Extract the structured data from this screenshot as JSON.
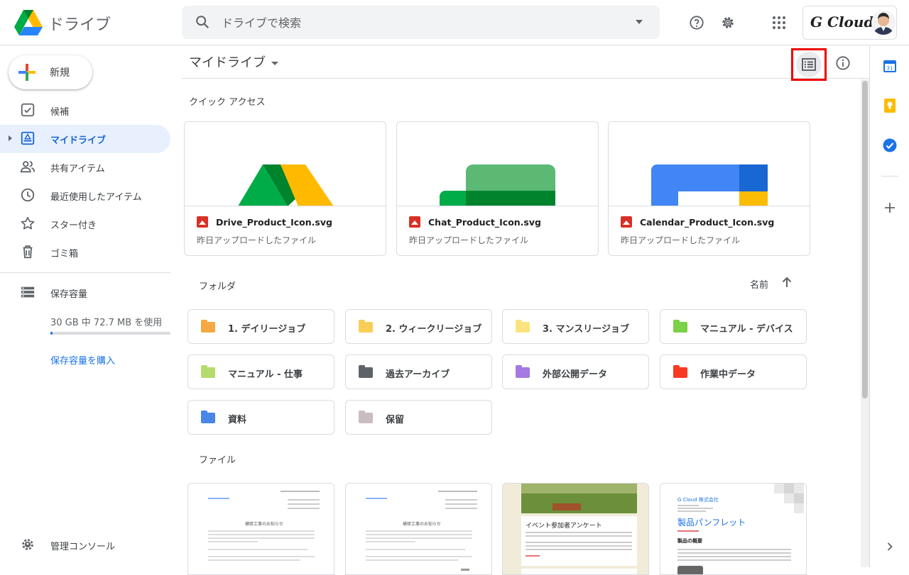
{
  "header": {
    "app_title": "ドライブ",
    "search_placeholder": "ドライブで検索",
    "account_brand": "G Cloud"
  },
  "sidebar": {
    "new_label": "新規",
    "items": [
      {
        "label": "候補",
        "icon": "suggested-icon"
      },
      {
        "label": "マイドライブ",
        "icon": "my-drive-icon",
        "active": true
      },
      {
        "label": "共有アイテム",
        "icon": "shared-icon"
      },
      {
        "label": "最近使用したアイテム",
        "icon": "recent-icon"
      },
      {
        "label": "スター付き",
        "icon": "star-icon"
      },
      {
        "label": "ゴミ箱",
        "icon": "trash-icon"
      }
    ],
    "storage_label": "保存容量",
    "storage_usage": "30 GB 中 72.7 MB を使用",
    "storage_fraction": 0.0024,
    "buy_storage": "保存容量を購入",
    "admin_console": "管理コンソール"
  },
  "main": {
    "title": "マイドライブ",
    "quick_access_title": "クイック アクセス",
    "quick_access": [
      {
        "name": "Drive_Product_Icon.svg",
        "sub": "昨日アップロードしたファイル"
      },
      {
        "name": "Chat_Product_Icon.svg",
        "sub": "昨日アップロードしたファイル"
      },
      {
        "name": "Calendar_Product_Icon.svg",
        "sub": "昨日アップロードしたファイル"
      }
    ],
    "folders_title": "フォルダ",
    "sort_label": "名前",
    "folders": [
      {
        "label": "1. デイリージョブ",
        "color": "#f6a842"
      },
      {
        "label": "2. ウィークリージョブ",
        "color": "#f8cf56"
      },
      {
        "label": "3. マンスリージョブ",
        "color": "#fbe47f"
      },
      {
        "label": "マニュアル - デバイス",
        "color": "#7bd148"
      },
      {
        "label": "マニュアル - 仕事",
        "color": "#b3dc6c"
      },
      {
        "label": "過去アーカイブ",
        "color": "#5f6368"
      },
      {
        "label": "外部公開データ",
        "color": "#a479e2"
      },
      {
        "label": "作業中データ",
        "color": "#f83a22"
      },
      {
        "label": "資料",
        "color": "#4986e7"
      },
      {
        "label": "保留",
        "color": "#cabdbf"
      }
    ],
    "files_title": "ファイル",
    "file_previews": {
      "notice_heading": "補修工事のお知らせ",
      "survey_heading": "イベント参加者アンケート",
      "brochure_company": "G Cloud 株式会社",
      "brochure_title": "製品パンフレット",
      "brochure_section": "製品の概要"
    }
  }
}
